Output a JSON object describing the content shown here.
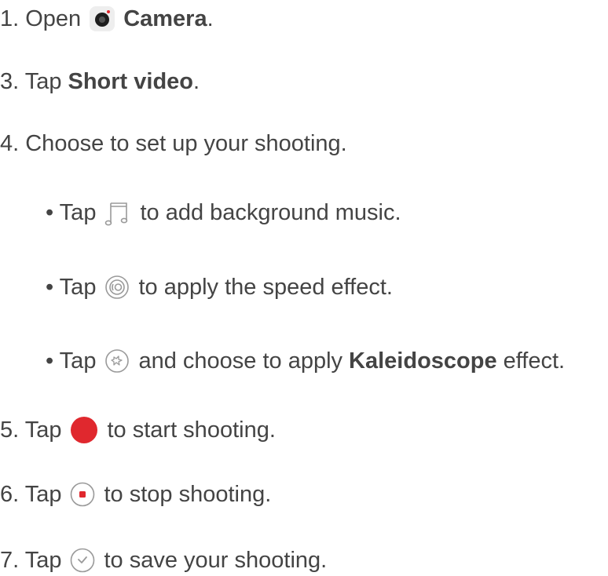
{
  "steps": [
    {
      "num": "1. Open",
      "bold": "Camera",
      "after": ".",
      "icon": "camera-icon"
    },
    {
      "num": "3. Tap",
      "bold": "Short video",
      "after": "."
    },
    {
      "num": "4. Choose to set up your shooting."
    },
    {
      "bullet": "• Tap",
      "after": "to add background music.",
      "icon": "music-note-icon"
    },
    {
      "bullet": "• Tap",
      "after": "to apply the speed effect.",
      "icon": "speed-icon"
    },
    {
      "bullet": "• Tap",
      "after_pre": "and choose to apply",
      "bold": "Kaleidoscope",
      "after": "effect.",
      "icon": "kaleidoscope-icon"
    },
    {
      "num": "5. Tap",
      "after": "to start shooting.",
      "icon": "record-button-icon"
    },
    {
      "num": "6. Tap",
      "after": "to stop shooting.",
      "icon": "stop-button-icon"
    },
    {
      "num": "7. Tap",
      "after": "to save your shooting.",
      "icon": "save-check-icon"
    }
  ],
  "colors": {
    "text": "#444444",
    "record_red": "#e0282e",
    "icon_gray": "#9a9a9a"
  }
}
